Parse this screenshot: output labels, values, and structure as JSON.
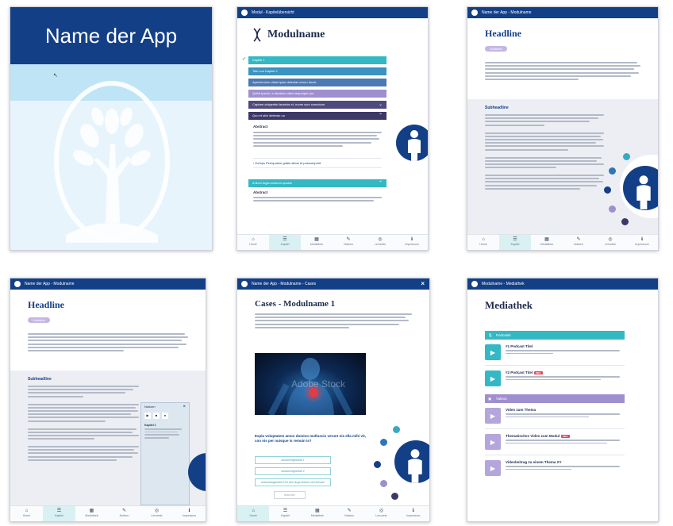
{
  "screens": {
    "splash": {
      "app_name": "Name der App"
    },
    "kapitel": {
      "topbar": "Modul - Kapitelübersicht",
      "module_title": "Modulname",
      "accordion": [
        {
          "label": "Kapitel 1",
          "color": "#34b8c4",
          "checked": true
        },
        {
          "label": "Titel von Kapitel 2",
          "color": "#3a93c2"
        },
        {
          "label": "Aperiat enim vitam ipsis delectat verum docet",
          "color": "#4a79b5"
        },
        {
          "label": "Quibil ipsum, a dicebam ultra nequeque pro",
          "color": "#9f8fcf"
        },
        {
          "label": "Captare cinigentis facsetur et, nume cum conectum",
          "color": "#4f4a7c"
        },
        {
          "label": "Quo et alicl delendo uo",
          "color": "#3d3867"
        }
      ],
      "abstract_label": "Abstract",
      "link_text": "› Eorbys Periopulem gratis albus et possumperit",
      "accordion_bottom": "A illum fugia solorum qualue",
      "abstract_label_2": "Abstract"
    },
    "headline1": {
      "topbar": "Name der App - Modulname",
      "headline": "Headline",
      "pill": "Sublabel",
      "subheadline": "Subheadline"
    },
    "headline2": {
      "topbar": "Name der App - Modulname",
      "headline": "Headline",
      "pill": "Sublabel",
      "subheadline": "Subheadline",
      "popup_title": "Notizen",
      "popup_sub": "Kapitel 1"
    },
    "cases": {
      "topbar": "Name der App - Modulname - Cases",
      "title": "Cases - Modulname 1",
      "question": "Expla voluptatem amoo domino molluscio verunt nis ella mihi vit, con nis per nuisque is remuin is?",
      "answers": [
        "Antwortmöglichkeit 1",
        "Antwortmöglichkeit 2",
        "Antwortmöglichkeit 3 für eine lange Antwort mit Umbruch",
        "Absenden"
      ],
      "watermark": "Adobe Stock"
    },
    "mediathek": {
      "topbar": "Modulname - Mediathek",
      "title": "Mediathek",
      "podcasts_label": "Podcasts",
      "podcasts": [
        {
          "title": "#1 Podcast Titel",
          "new": false
        },
        {
          "title": "#2 Podcast Titel",
          "new": true
        }
      ],
      "videos_label": "Videos",
      "videos": [
        {
          "title": "Video zum Thema",
          "new": false
        },
        {
          "title": "Thematisches Video zum Modul",
          "new": true
        },
        {
          "title": "Videobeitrag zu einem Thema XY",
          "new": false
        }
      ],
      "new_badge": "NEU"
    },
    "nav": [
      {
        "label": "Home",
        "icon": "⌂"
      },
      {
        "label": "Kapitel",
        "icon": "☰"
      },
      {
        "label": "Mediathek",
        "icon": "▦"
      },
      {
        "label": "Notizen",
        "icon": "✎"
      },
      {
        "label": "Lernziele",
        "icon": "◎"
      },
      {
        "label": "Impressum",
        "icon": "ℹ"
      }
    ]
  },
  "colors": {
    "navy": "#133f87",
    "teal": "#34b8c4",
    "purple": "#9f8fcf",
    "lightblue": "#b7dff3"
  }
}
